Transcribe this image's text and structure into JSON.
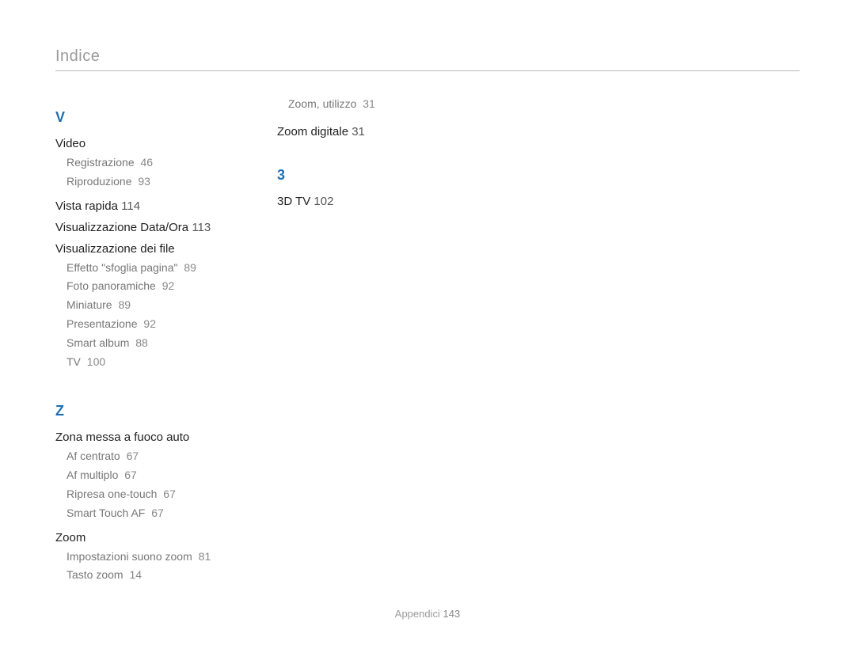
{
  "header": "Indice",
  "footer_label": "Appendici",
  "footer_page": "143",
  "col1": {
    "sections": [
      {
        "letter": "V",
        "entries": [
          {
            "title": "Video",
            "page": "",
            "sub": [
              {
                "label": "Registrazione",
                "page": "46"
              },
              {
                "label": "Riproduzione",
                "page": "93"
              }
            ]
          },
          {
            "title": "Vista rapida",
            "page": "114",
            "sub": []
          },
          {
            "title": "Visualizzazione Data/Ora",
            "page": "113",
            "sub": []
          },
          {
            "title": "Visualizzazione dei file",
            "page": "",
            "sub": [
              {
                "label": "Effetto \"sfoglia pagina\"",
                "page": "89"
              },
              {
                "label": "Foto panoramiche",
                "page": "92"
              },
              {
                "label": "Miniature",
                "page": "89"
              },
              {
                "label": "Presentazione",
                "page": "92"
              },
              {
                "label": "Smart album",
                "page": "88"
              },
              {
                "label": "TV",
                "page": "100"
              }
            ]
          }
        ]
      },
      {
        "letter": "Z",
        "entries": [
          {
            "title": "Zona messa a fuoco auto",
            "page": "",
            "sub": [
              {
                "label": "Af centrato",
                "page": "67"
              },
              {
                "label": "Af multiplo",
                "page": "67"
              },
              {
                "label": "Ripresa one-touch",
                "page": "67"
              },
              {
                "label": "Smart Touch AF",
                "page": "67"
              }
            ]
          },
          {
            "title": "Zoom",
            "page": "",
            "sub": [
              {
                "label": "Impostazioni suono zoom",
                "page": "81"
              },
              {
                "label": "Tasto zoom",
                "page": "14"
              }
            ]
          }
        ]
      }
    ]
  },
  "col2": {
    "leading_sub": {
      "label": "Zoom, utilizzo",
      "page": "31"
    },
    "entries_top": [
      {
        "title": "Zoom digitale",
        "page": "31",
        "sub": []
      }
    ],
    "sections": [
      {
        "letter": "3",
        "entries": [
          {
            "title": "3D TV",
            "page": "102",
            "sub": []
          }
        ]
      }
    ]
  }
}
